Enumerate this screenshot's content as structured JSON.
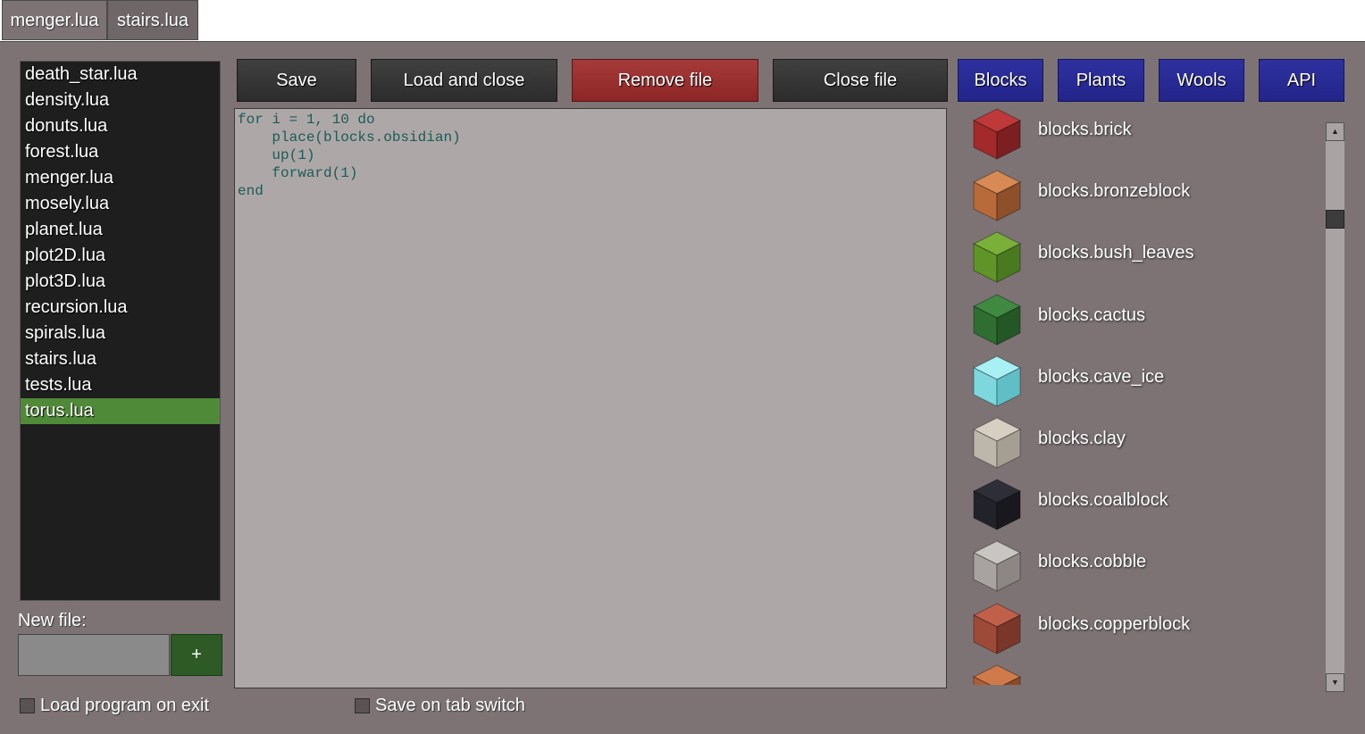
{
  "tabs": [
    {
      "label": "menger.lua"
    },
    {
      "label": "stairs.lua"
    }
  ],
  "files": [
    "death_star.lua",
    "density.lua",
    "donuts.lua",
    "forest.lua",
    "menger.lua",
    "mosely.lua",
    "planet.lua",
    "plot2D.lua",
    "plot3D.lua",
    "recursion.lua",
    "spirals.lua",
    "stairs.lua",
    "tests.lua",
    "torus.lua"
  ],
  "selected_file": "torus.lua",
  "new_file": {
    "label": "New file:",
    "value": "",
    "add_label": "+"
  },
  "toolbar": {
    "save": "Save",
    "load_close": "Load and close",
    "remove": "Remove file",
    "close": "Close file",
    "blocks": "Blocks",
    "plants": "Plants",
    "wools": "Wools",
    "api": "API"
  },
  "code": [
    "for i = 1, 10 do",
    "    place(blocks.obsidian)",
    "    up(1)",
    "    forward(1)",
    "end"
  ],
  "blocks": [
    {
      "name": "blocks.brick",
      "icon": "brick-block-icon",
      "top": "#c0393a",
      "left": "#a22a2b",
      "right": "#7d1f20"
    },
    {
      "name": "blocks.bronzeblock",
      "icon": "bronze-block-icon",
      "top": "#d88a55",
      "left": "#b86a3a",
      "right": "#8e4f2b"
    },
    {
      "name": "blocks.bush_leaves",
      "icon": "bush-leaves-block-icon",
      "top": "#7ab03a",
      "left": "#5f9428",
      "right": "#4a7a1f"
    },
    {
      "name": "blocks.cactus",
      "icon": "cactus-block-icon",
      "top": "#3f8a40",
      "left": "#2f6e31",
      "right": "#245726"
    },
    {
      "name": "blocks.cave_ice",
      "icon": "cave-ice-block-icon",
      "top": "#a8f0f4",
      "left": "#7fd7de",
      "right": "#5fbec6"
    },
    {
      "name": "blocks.clay",
      "icon": "clay-block-icon",
      "top": "#d6cfc2",
      "left": "#bdb6aa",
      "right": "#a59e93"
    },
    {
      "name": "blocks.coalblock",
      "icon": "coal-block-icon",
      "top": "#2e2e38",
      "left": "#22222a",
      "right": "#18181e"
    },
    {
      "name": "blocks.cobble",
      "icon": "cobble-block-icon",
      "top": "#c9c5c3",
      "left": "#a8a3a1",
      "right": "#8c8785"
    },
    {
      "name": "blocks.copperblock",
      "icon": "copper-block-icon",
      "top": "#c0604a",
      "left": "#9e4a38",
      "right": "#7a3729"
    },
    {
      "name": "",
      "icon": "partial-block-icon",
      "top": "#d07a4a",
      "left": "#b05f35",
      "right": "#8e4a29"
    }
  ],
  "options": {
    "load_on_exit": "Load program on exit",
    "save_on_switch": "Save on tab switch"
  }
}
